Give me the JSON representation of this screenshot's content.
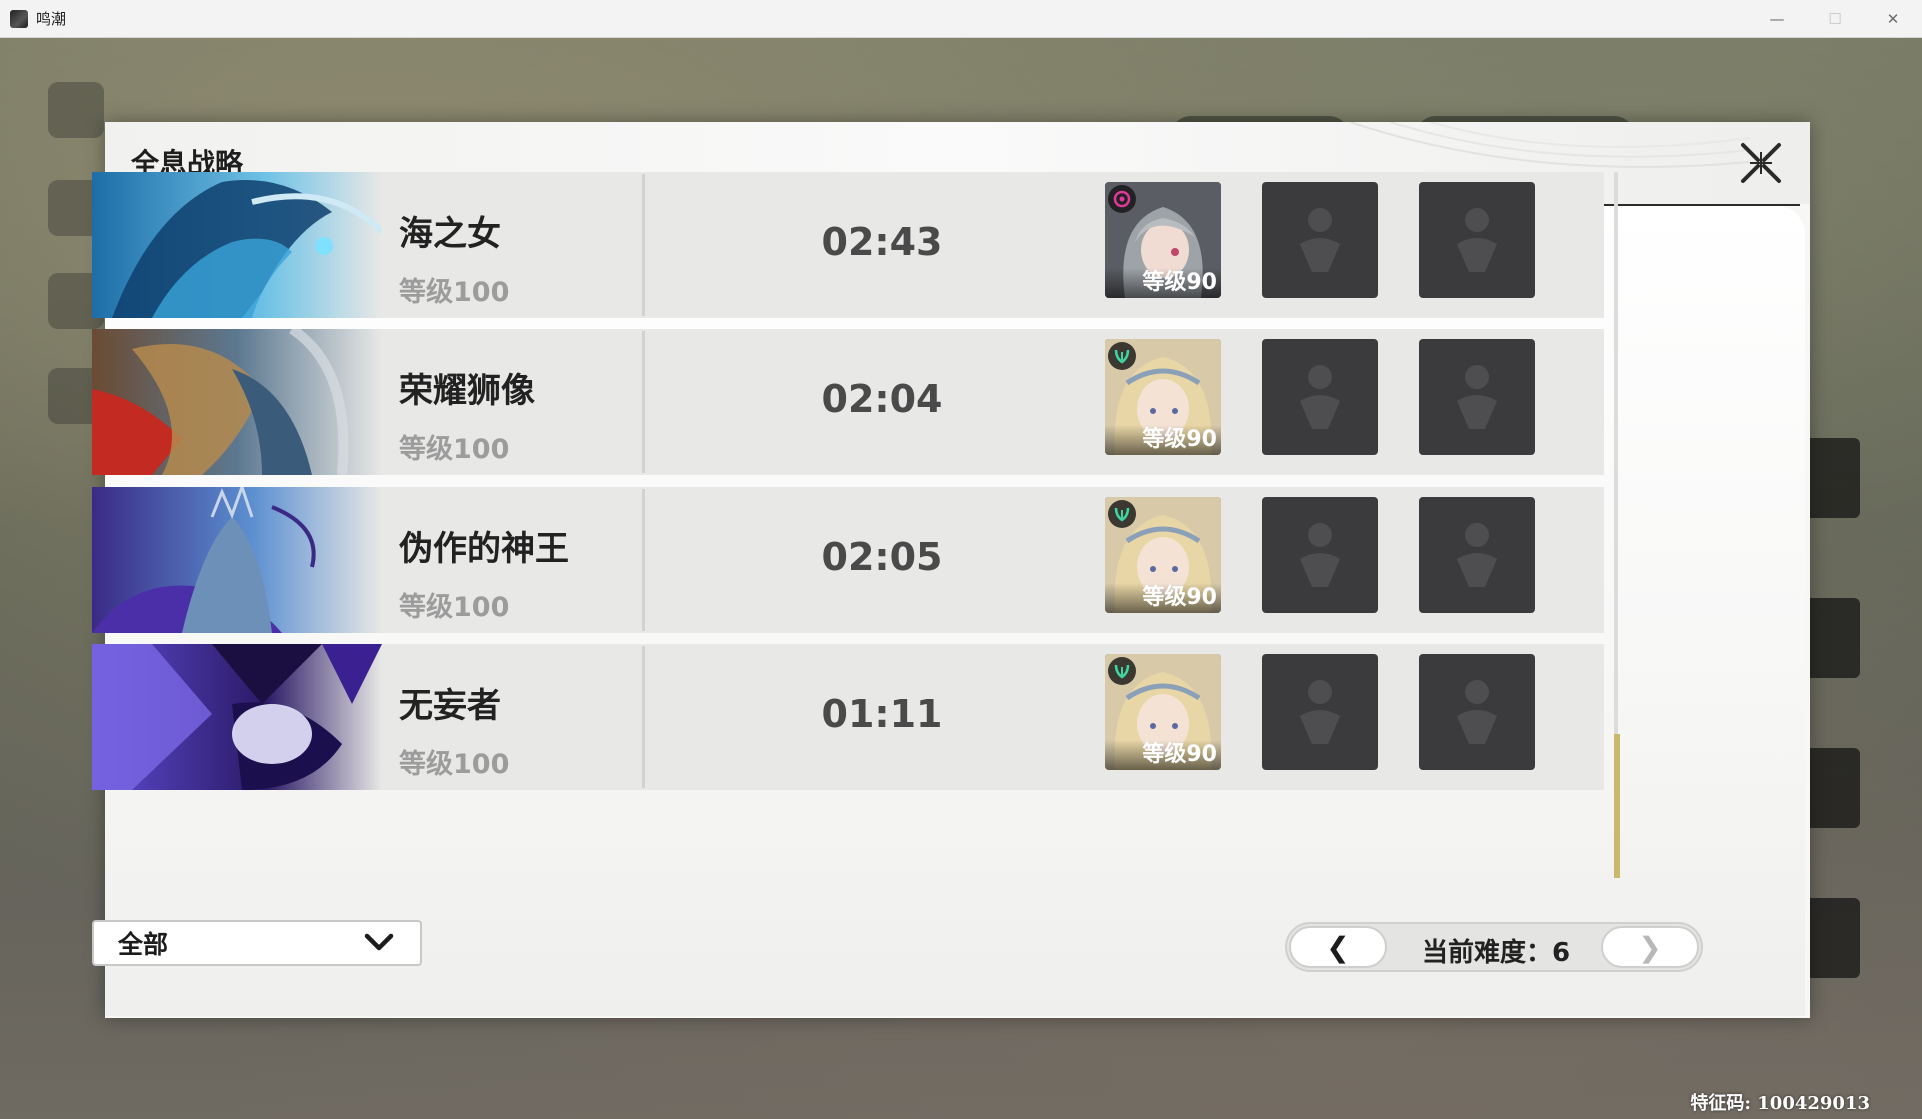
{
  "window": {
    "title": "鸣潮",
    "minimize": "—",
    "maximize": "☐",
    "close": "✕"
  },
  "modal": {
    "title": "全息战略"
  },
  "bosses": [
    {
      "name": "海之女",
      "level": "等级100",
      "time": "02:43",
      "char_level": "等级90",
      "element_color": "#e0399a"
    },
    {
      "name": "荣耀狮像",
      "level": "等级100",
      "time": "02:04",
      "char_level": "等级90",
      "element_color": "#3fd6a0"
    },
    {
      "name": "伪作的神王",
      "level": "等级100",
      "time": "02:05",
      "char_level": "等级90",
      "element_color": "#3fd6a0"
    },
    {
      "name": "无妄者",
      "level": "等级100",
      "time": "01:11",
      "char_level": "等级90",
      "element_color": "#3fd6a0"
    }
  ],
  "filter": {
    "selected": "全部"
  },
  "difficulty": {
    "label": "当前难度：6",
    "prev": "❮",
    "next": "❯"
  },
  "footer": {
    "feature_code": "特征码: 100429013"
  },
  "colors": {
    "accent_gold": "#c9b96c",
    "empty_slot": "#3b3b3d"
  }
}
